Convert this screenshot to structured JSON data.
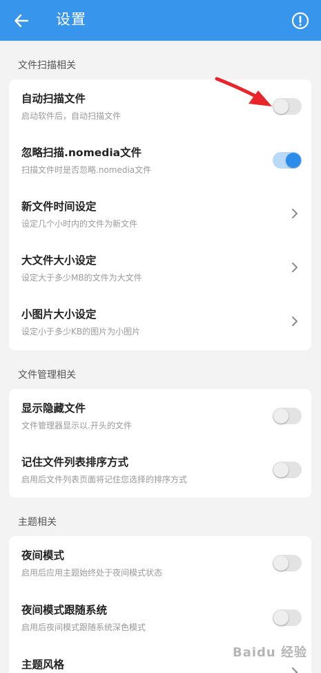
{
  "header": {
    "title": "设置",
    "back_icon": "arrow-left-icon",
    "info_icon": "info-circle-icon",
    "color": "#3795ec"
  },
  "sections": {
    "scan": {
      "title": "文件扫描相关",
      "items": [
        {
          "title": "自动扫描文件",
          "subtitle": "启动软件后，自动扫描文件",
          "type": "switch",
          "on": false
        },
        {
          "title": "忽略扫描.nomedia文件",
          "subtitle": "扫描文件时是否忽略.nomedia文件",
          "type": "switch",
          "on": true
        },
        {
          "title": "新文件时间设定",
          "subtitle": "设定几个小时内的文件为新文件",
          "type": "chevron"
        },
        {
          "title": "大文件大小设定",
          "subtitle": "设定大于多少MB的文件为大文件",
          "type": "chevron"
        },
        {
          "title": "小图片大小设定",
          "subtitle": "设定小于多少KB的图片为小图片",
          "type": "chevron"
        }
      ]
    },
    "manage": {
      "title": "文件管理相关",
      "items": [
        {
          "title": "显示隐藏文件",
          "subtitle": "文件管理器显示以.开头的文件",
          "type": "switch",
          "on": false
        },
        {
          "title": "记住文件列表排序方式",
          "subtitle": "启用后文件列表页面将记住您选择的排序方式",
          "type": "switch",
          "on": false
        }
      ]
    },
    "theme": {
      "title": "主题相关",
      "items": [
        {
          "title": "夜间模式",
          "subtitle": "启用后应用主题始终处于夜间模式状态",
          "type": "switch",
          "on": false
        },
        {
          "title": "夜间模式跟随系统",
          "subtitle": "启用后夜间模式跟随系统深色模式",
          "type": "switch",
          "on": false
        },
        {
          "title": "主题风格",
          "subtitle": "",
          "type": "chevron"
        }
      ]
    }
  },
  "annotation_icon": "red-arrow-icon",
  "watermark": "Baidu 经验"
}
